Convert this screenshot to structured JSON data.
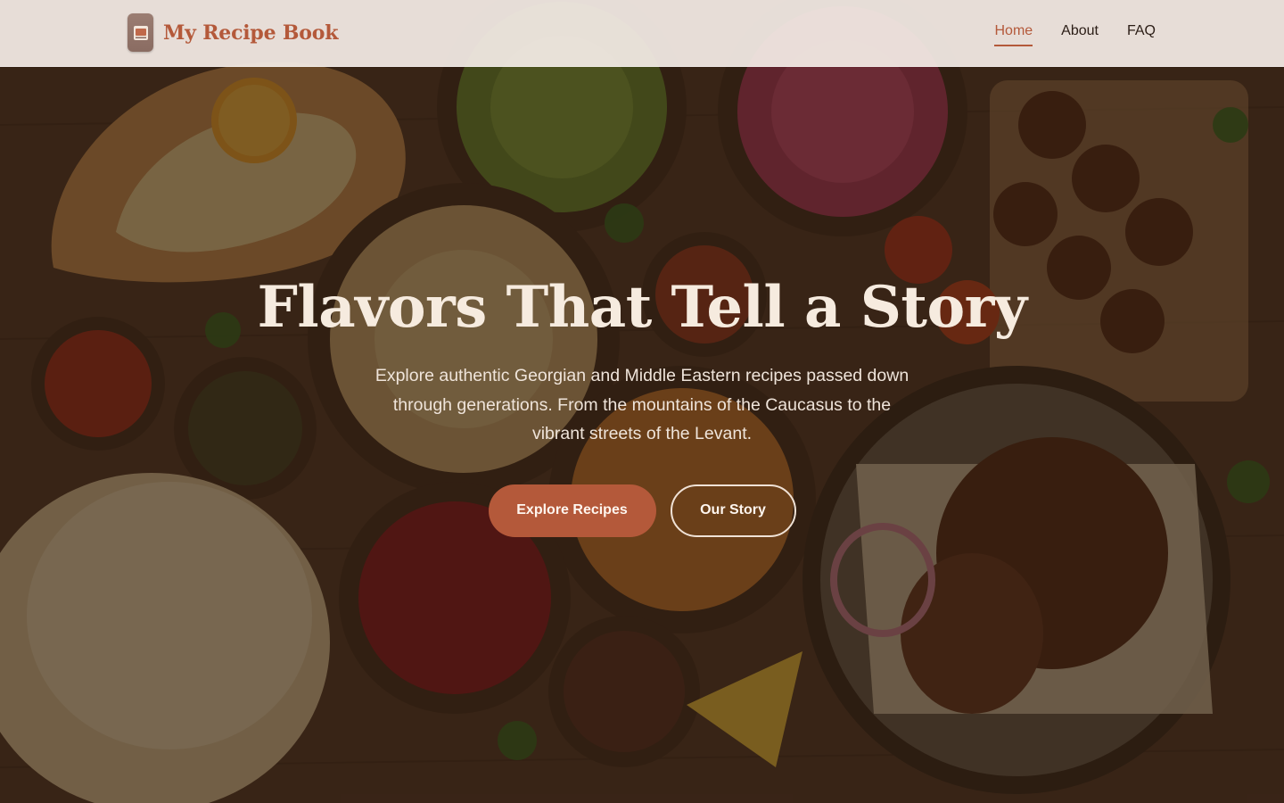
{
  "header": {
    "brand_name": "My Recipe Book",
    "logo_icon": "recipe-book-logo",
    "nav": [
      {
        "label": "Home",
        "active": true
      },
      {
        "label": "About",
        "active": false
      },
      {
        "label": "FAQ",
        "active": false
      }
    ]
  },
  "hero": {
    "title": "Flavors That Tell a Story",
    "subtitle": "Explore authentic Georgian and Middle Eastern recipes passed down through generations. From the mountains of the Caucasus to the vibrant streets of the Levant.",
    "primary_button": "Explore Recipes",
    "secondary_button": "Our Story",
    "background": "food-spread-image"
  },
  "colors": {
    "accent": "#b4593a",
    "header_bg": "#f4ece6",
    "hero_text": "#f6ebdf"
  }
}
